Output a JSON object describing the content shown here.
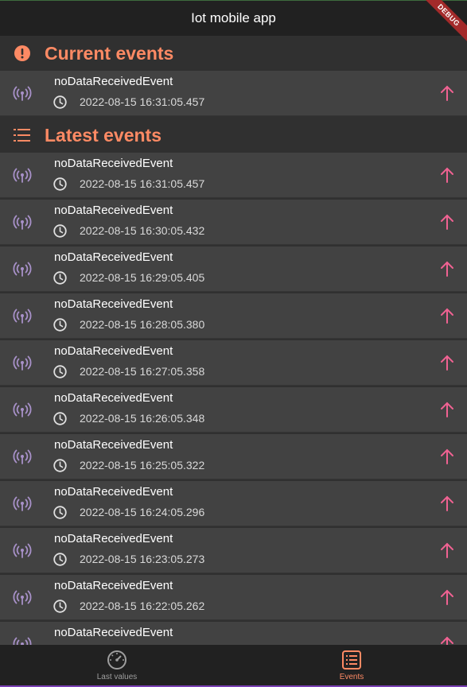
{
  "app": {
    "title": "Iot mobile app",
    "debug_label": "DEBUG"
  },
  "colors": {
    "accent": "#fd8a64",
    "signal": "#a891c9",
    "arrow": "#f06292",
    "row_bg": "#424242"
  },
  "current": {
    "title": "Current events",
    "icon": "alert-circle-icon",
    "events": [
      {
        "name": "noDataReceivedEvent",
        "time": "2022-08-15 16:31:05.457"
      }
    ]
  },
  "latest": {
    "title": "Latest events",
    "icon": "list-icon",
    "events": [
      {
        "name": "noDataReceivedEvent",
        "time": "2022-08-15 16:31:05.457"
      },
      {
        "name": "noDataReceivedEvent",
        "time": "2022-08-15 16:30:05.432"
      },
      {
        "name": "noDataReceivedEvent",
        "time": "2022-08-15 16:29:05.405"
      },
      {
        "name": "noDataReceivedEvent",
        "time": "2022-08-15 16:28:05.380"
      },
      {
        "name": "noDataReceivedEvent",
        "time": "2022-08-15 16:27:05.358"
      },
      {
        "name": "noDataReceivedEvent",
        "time": "2022-08-15 16:26:05.348"
      },
      {
        "name": "noDataReceivedEvent",
        "time": "2022-08-15 16:25:05.322"
      },
      {
        "name": "noDataReceivedEvent",
        "time": "2022-08-15 16:24:05.296"
      },
      {
        "name": "noDataReceivedEvent",
        "time": "2022-08-15 16:23:05.273"
      },
      {
        "name": "noDataReceivedEvent",
        "time": "2022-08-15 16:22:05.262"
      },
      {
        "name": "noDataReceivedEvent",
        "time": ""
      }
    ]
  },
  "nav": {
    "items": [
      {
        "label": "Last values",
        "icon": "speedometer-icon",
        "active": false
      },
      {
        "label": "Events",
        "icon": "list-box-icon",
        "active": true
      }
    ]
  }
}
